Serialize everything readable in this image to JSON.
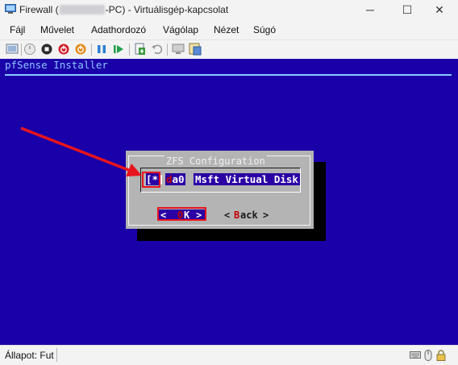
{
  "window": {
    "title_prefix": "Firewall (",
    "title_suffix": "-PC) - Virtuálisgép-kapcsolat",
    "minimize_glyph": "─",
    "maximize_glyph": "☐",
    "close_glyph": "✕"
  },
  "menu": [
    {
      "label": "Fájl"
    },
    {
      "label": "Művelet"
    },
    {
      "label": "Adathordozó"
    },
    {
      "label": "Vágólap"
    },
    {
      "label": "Nézet"
    },
    {
      "label": "Súgó"
    }
  ],
  "toolbar": {
    "icons": [
      "ctrl-alt-del-icon",
      "start-icon",
      "turn-off-icon",
      "shut-down-icon",
      "save-icon",
      "pause-icon",
      "resume-icon",
      "checkpoint-icon",
      "revert-icon",
      "enhanced-session-icon",
      "share-icon"
    ]
  },
  "console": {
    "header": "pfSense Installer",
    "dialog": {
      "title": "ZFS Configuration",
      "checkbox": "[*]",
      "device_first": "d",
      "device_rest": "a0",
      "device_desc": "Msft Virtual Disk",
      "ok_left": "<",
      "ok_hot": "O",
      "ok_rest": "K",
      "ok_right": ">",
      "back_left": "<",
      "back_hot": "B",
      "back_rest": "ack",
      "back_right": ">"
    }
  },
  "status": {
    "label": "Állapot: Fut"
  },
  "colors": {
    "console_bg": "#1a00a8",
    "dialog_bg": "#b4b4b4",
    "highlight_bg": "#2a00a4",
    "header_text": "#8cc8ff",
    "hotkey": "#c40000",
    "annotation": "#e8141e"
  }
}
